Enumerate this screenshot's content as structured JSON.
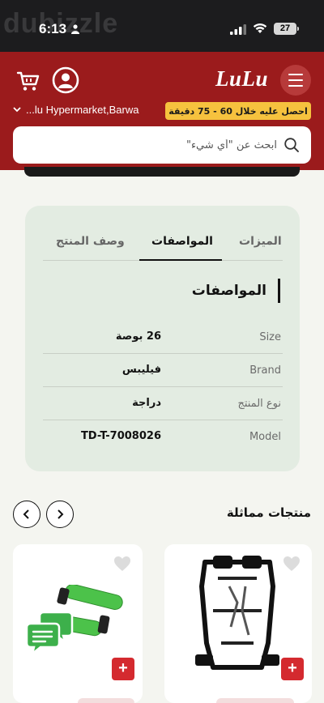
{
  "status_bar": {
    "time": "6:13",
    "battery": "27",
    "watermark": "dubizzle"
  },
  "header": {
    "logo": "LuLu",
    "location": "...lu Hypermarket,Barwa",
    "delivery_badge": "احصل عليه خلال 60 - 75 دقيقة",
    "search_placeholder": "ابحث عن \"أي شيء\""
  },
  "specs": {
    "tabs": [
      "الميزات",
      "المواصفات",
      "وصف المنتج"
    ],
    "active_tab": "المواصفات",
    "title": "المواصفات",
    "rows": [
      {
        "key": "Size",
        "value": "26 بوصة"
      },
      {
        "key": "Brand",
        "value": "فيليبس"
      },
      {
        "key": "نوع المنتج",
        "value": "دراجة"
      },
      {
        "key": "Model",
        "value": "TD-T-7008026"
      }
    ]
  },
  "similar": {
    "title": "منتجات مماثلة",
    "products": [
      {
        "image": "bike-rack-image"
      },
      {
        "image": "green-bike-grips-image"
      }
    ]
  },
  "colors": {
    "brand_red": "#9b1b1c",
    "badge_yellow": "#f6c23e",
    "card_green": "#e3ece2",
    "add_red": "#d42a2f",
    "chat_green": "#3db04b"
  },
  "icons": {
    "cart": "cart-icon",
    "account": "user-circle-icon",
    "menu": "hamburger-icon",
    "location_chevron": "chevron-down-icon",
    "search": "search-icon",
    "prev": "chevron-left-icon",
    "next": "chevron-right-icon",
    "wishlist": "heart-icon",
    "add": "plus-icon",
    "chat": "chat-icon"
  }
}
